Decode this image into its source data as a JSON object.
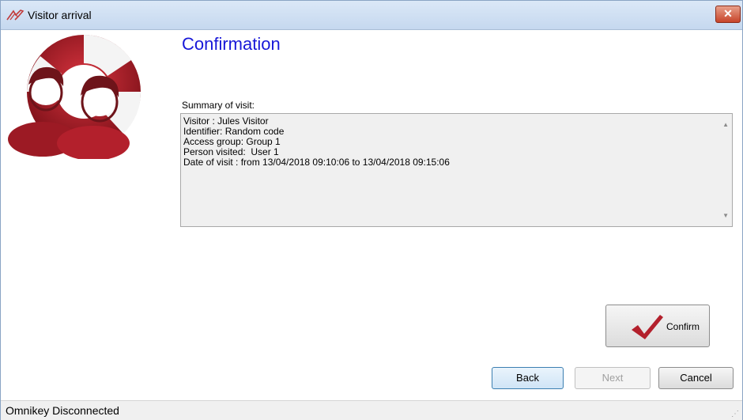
{
  "window": {
    "title": "Visitor arrival",
    "close_label": "✕"
  },
  "page": {
    "heading": "Confirmation",
    "summary_label": "Summary of visit:",
    "summary_lines": [
      "Visitor : Jules Visitor",
      "Identifier: Random code",
      "Access group: Group 1",
      "Person visited:  User 1",
      "Date of visit : from 13/04/2018 09:10:06 to 13/04/2018 09:15:06"
    ]
  },
  "actions": {
    "confirm_label": "Confirm",
    "back_label": "Back",
    "next_label": "Next",
    "cancel_label": "Cancel"
  },
  "status": {
    "text": "Omnikey Disconnected"
  },
  "icons": {
    "app": "visitor-app-icon",
    "logo": "visitor-lifebuoy-logo",
    "confirm": "checkmark-icon",
    "scroll_up": "scroll-up-arrow-icon",
    "scroll_down": "scroll-down-arrow-icon"
  },
  "colors": {
    "heading": "#1818d8",
    "logo_red": "#b3202c",
    "close_button": "#c7442a"
  }
}
